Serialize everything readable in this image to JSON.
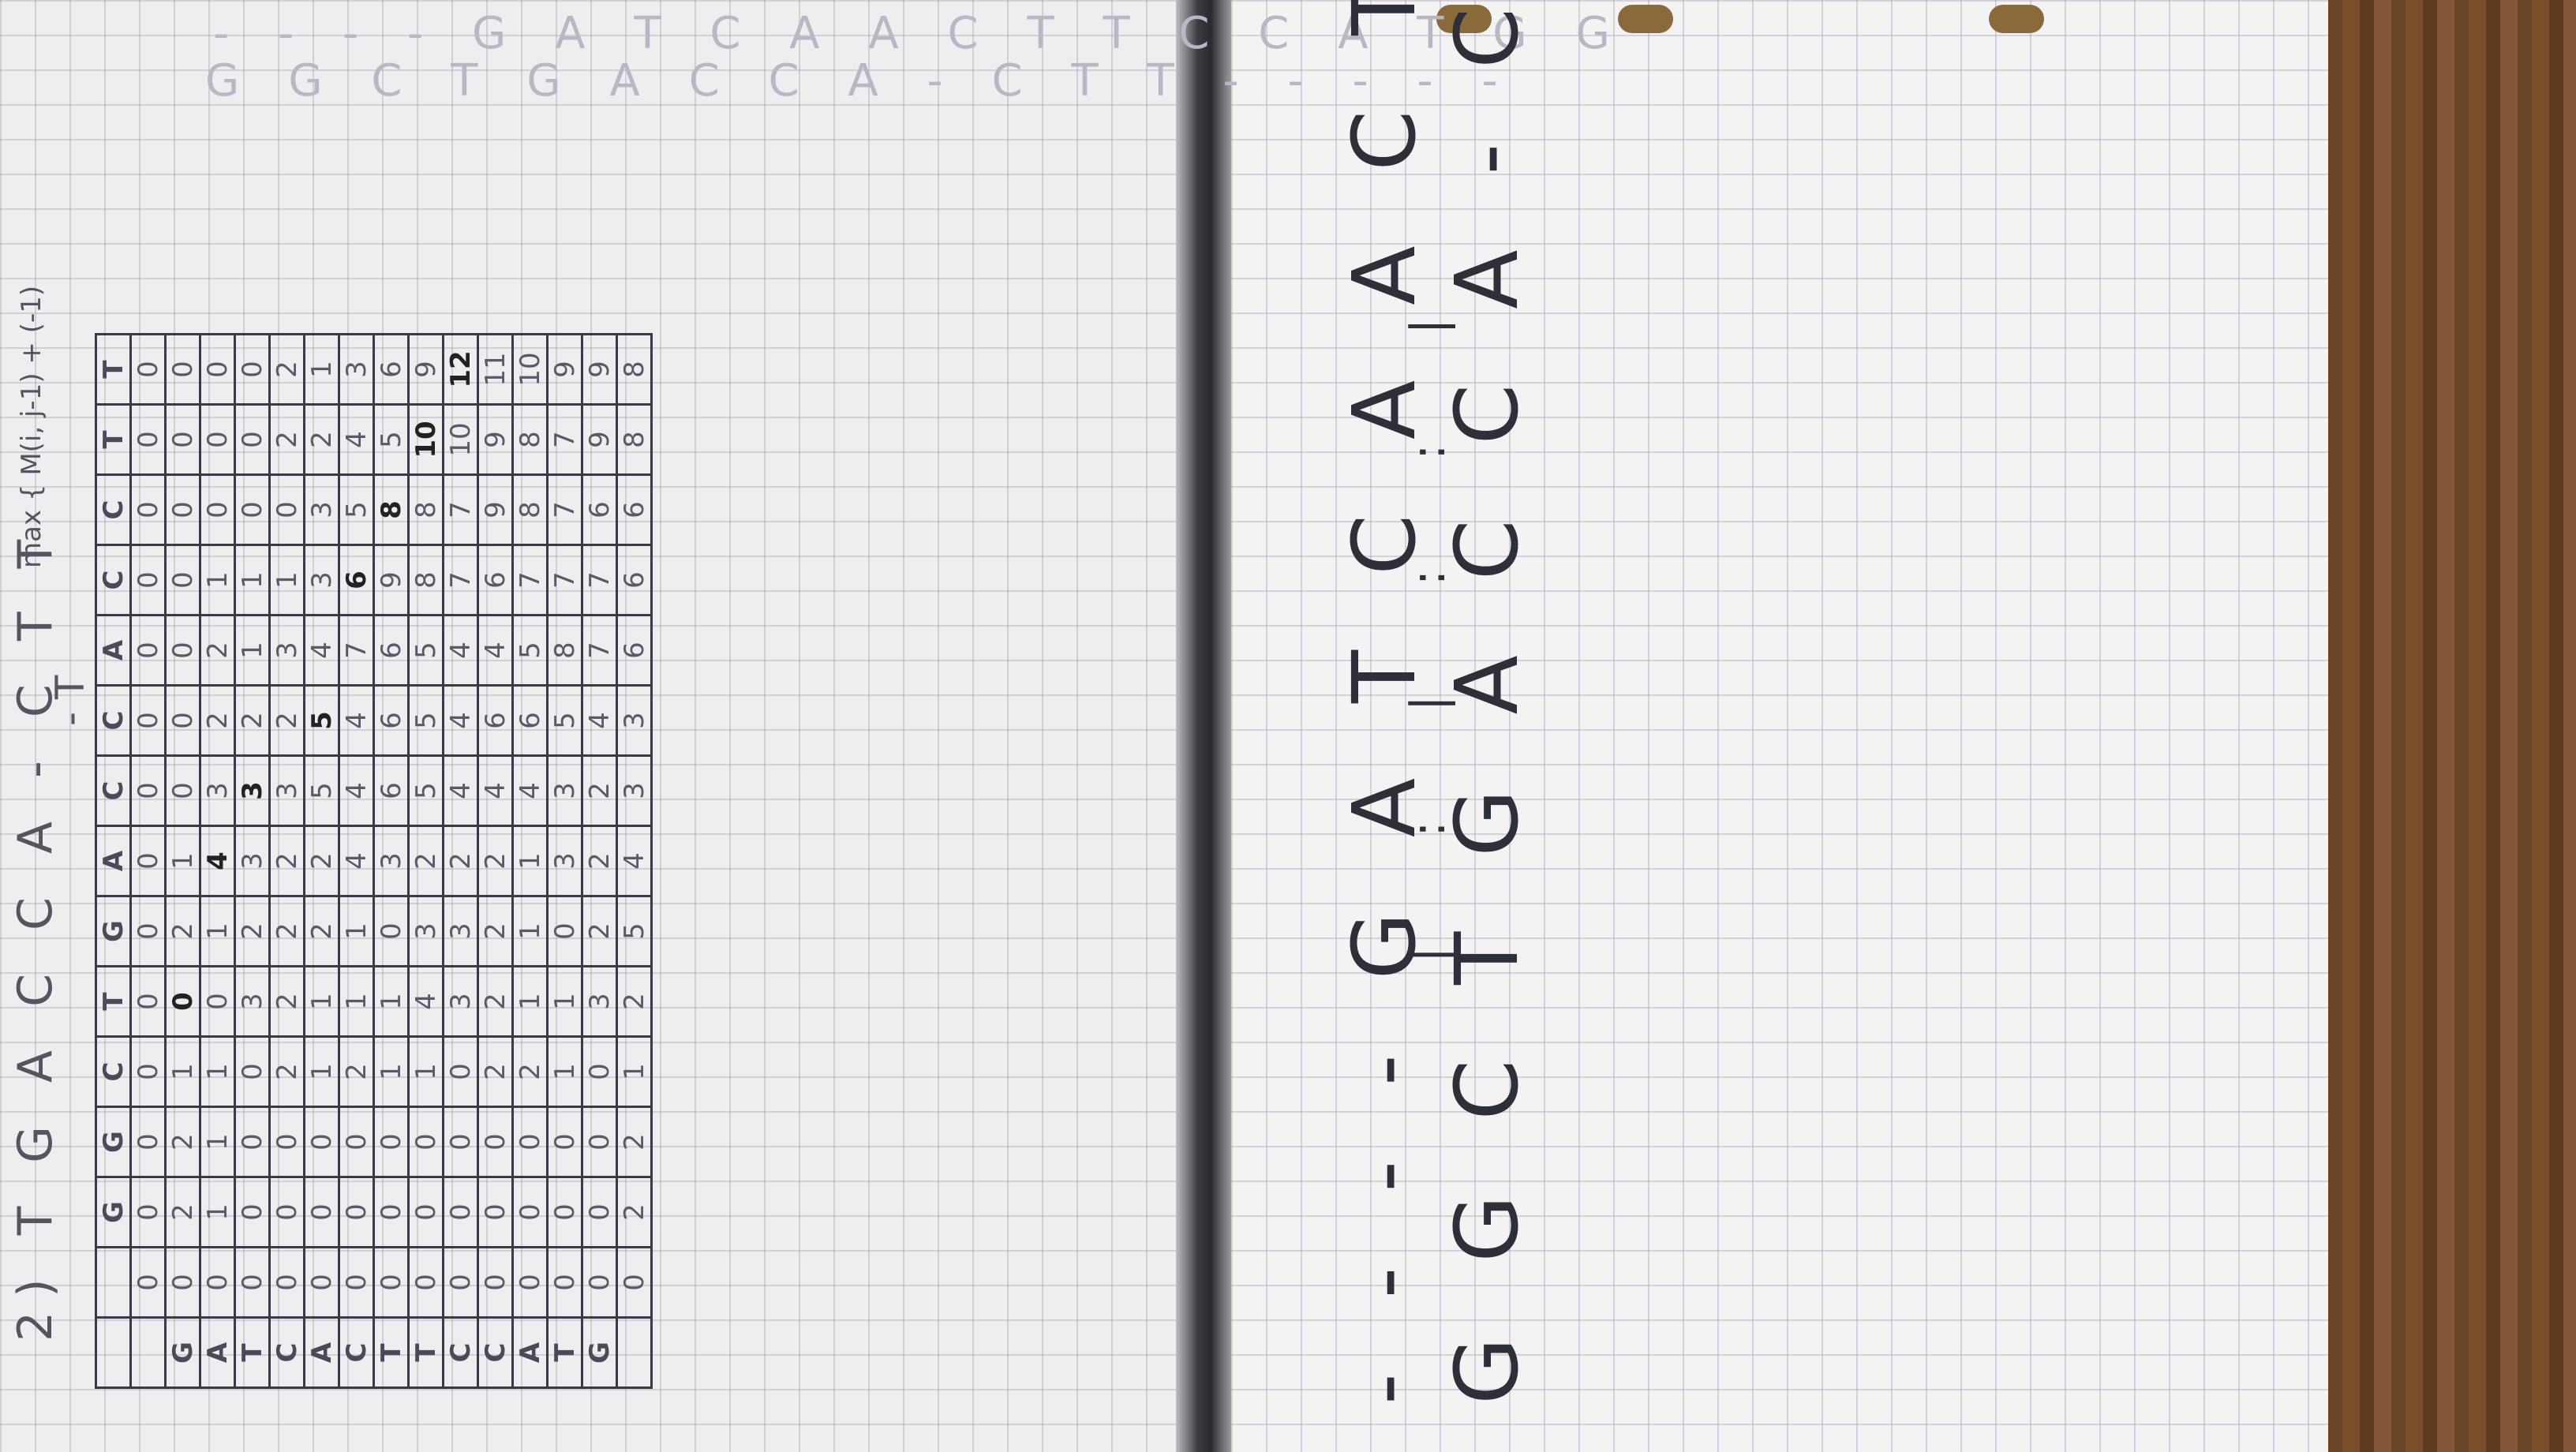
{
  "problem_label": "2)",
  "top_alignment": {
    "line1": "T G A C C A - C T T",
    "line2": "- T"
  },
  "faint_notes": {
    "seq1": "- - - - G A T C A A C T T C C A T G G",
    "seq2": "G G C T G A C C A - C T T - - - - -"
  },
  "recurrence_note": "max { M(i, j-1) + (-1)",
  "column_headers": [
    "G",
    "G",
    "C",
    "T",
    "G",
    "A",
    "C",
    "C",
    "A",
    "C",
    "C",
    "T",
    "T"
  ],
  "row_headers": [
    "G",
    "A",
    "T",
    "C",
    "A",
    "C",
    "T",
    "T",
    "C",
    "C",
    "A",
    "T",
    "G"
  ],
  "matrix": [
    [
      "0",
      "0",
      "0",
      "0",
      "0",
      "0",
      "0",
      "0",
      "0",
      "0",
      "0",
      "0",
      "0",
      "0"
    ],
    [
      "0",
      "2",
      "2",
      "1",
      "0",
      "2",
      "1",
      "0",
      "0",
      "0",
      "0",
      "0",
      "0",
      "0"
    ],
    [
      "0",
      "1",
      "1",
      "1",
      "0",
      "1",
      "4",
      "3",
      "2",
      "2",
      "1",
      "0",
      "0",
      "0"
    ],
    [
      "0",
      "0",
      "0",
      "0",
      "3",
      "2",
      "3",
      "3",
      "2",
      "1",
      "1",
      "0",
      "0",
      "0"
    ],
    [
      "0",
      "0",
      "0",
      "2",
      "2",
      "2",
      "2",
      "3",
      "2",
      "3",
      "1",
      "0",
      "2",
      "2"
    ],
    [
      "0",
      "0",
      "0",
      "1",
      "1",
      "2",
      "2",
      "5",
      "5",
      "4",
      "3",
      "3",
      "2",
      "1"
    ],
    [
      "0",
      "0",
      "0",
      "2",
      "1",
      "1",
      "4",
      "4",
      "4",
      "7",
      "6",
      "5",
      "4",
      "3"
    ],
    [
      "0",
      "0",
      "0",
      "1",
      "1",
      "0",
      "3",
      "6",
      "6",
      "6",
      "9",
      "8",
      "5",
      "6"
    ],
    [
      "0",
      "0",
      "0",
      "1",
      "4",
      "3",
      "2",
      "5",
      "5",
      "5",
      "8",
      "8",
      "10",
      "9"
    ],
    [
      "0",
      "0",
      "0",
      "0",
      "3",
      "3",
      "2",
      "4",
      "4",
      "4",
      "7",
      "7",
      "10",
      "12"
    ],
    [
      "0",
      "0",
      "0",
      "2",
      "2",
      "2",
      "2",
      "4",
      "6",
      "4",
      "6",
      "9",
      "9",
      "11"
    ],
    [
      "0",
      "0",
      "0",
      "2",
      "1",
      "1",
      "1",
      "4",
      "6",
      "5",
      "7",
      "8",
      "8",
      "10"
    ],
    [
      "0",
      "0",
      "0",
      "1",
      "1",
      "0",
      "3",
      "3",
      "5",
      "8",
      "7",
      "7",
      "7",
      "9"
    ],
    [
      "0",
      "0",
      "0",
      "0",
      "3",
      "2",
      "2",
      "2",
      "4",
      "7",
      "7",
      "6",
      "9",
      "9"
    ],
    [
      "0",
      "2",
      "2",
      "1",
      "2",
      "5",
      "4",
      "3",
      "3",
      "6",
      "6",
      "6",
      "8",
      "8"
    ]
  ],
  "bold_cells": [
    "1-4",
    "2-6",
    "3-7",
    "5-8",
    "6-10",
    "7-11",
    "8-12",
    "9-13"
  ],
  "final_alignment": {
    "top": "- - - - G A T C A A C T T C C A T G G",
    "middle": "| : | : : |",
    "bottom": "G G C T G A C C A - C T T - - - - -"
  }
}
